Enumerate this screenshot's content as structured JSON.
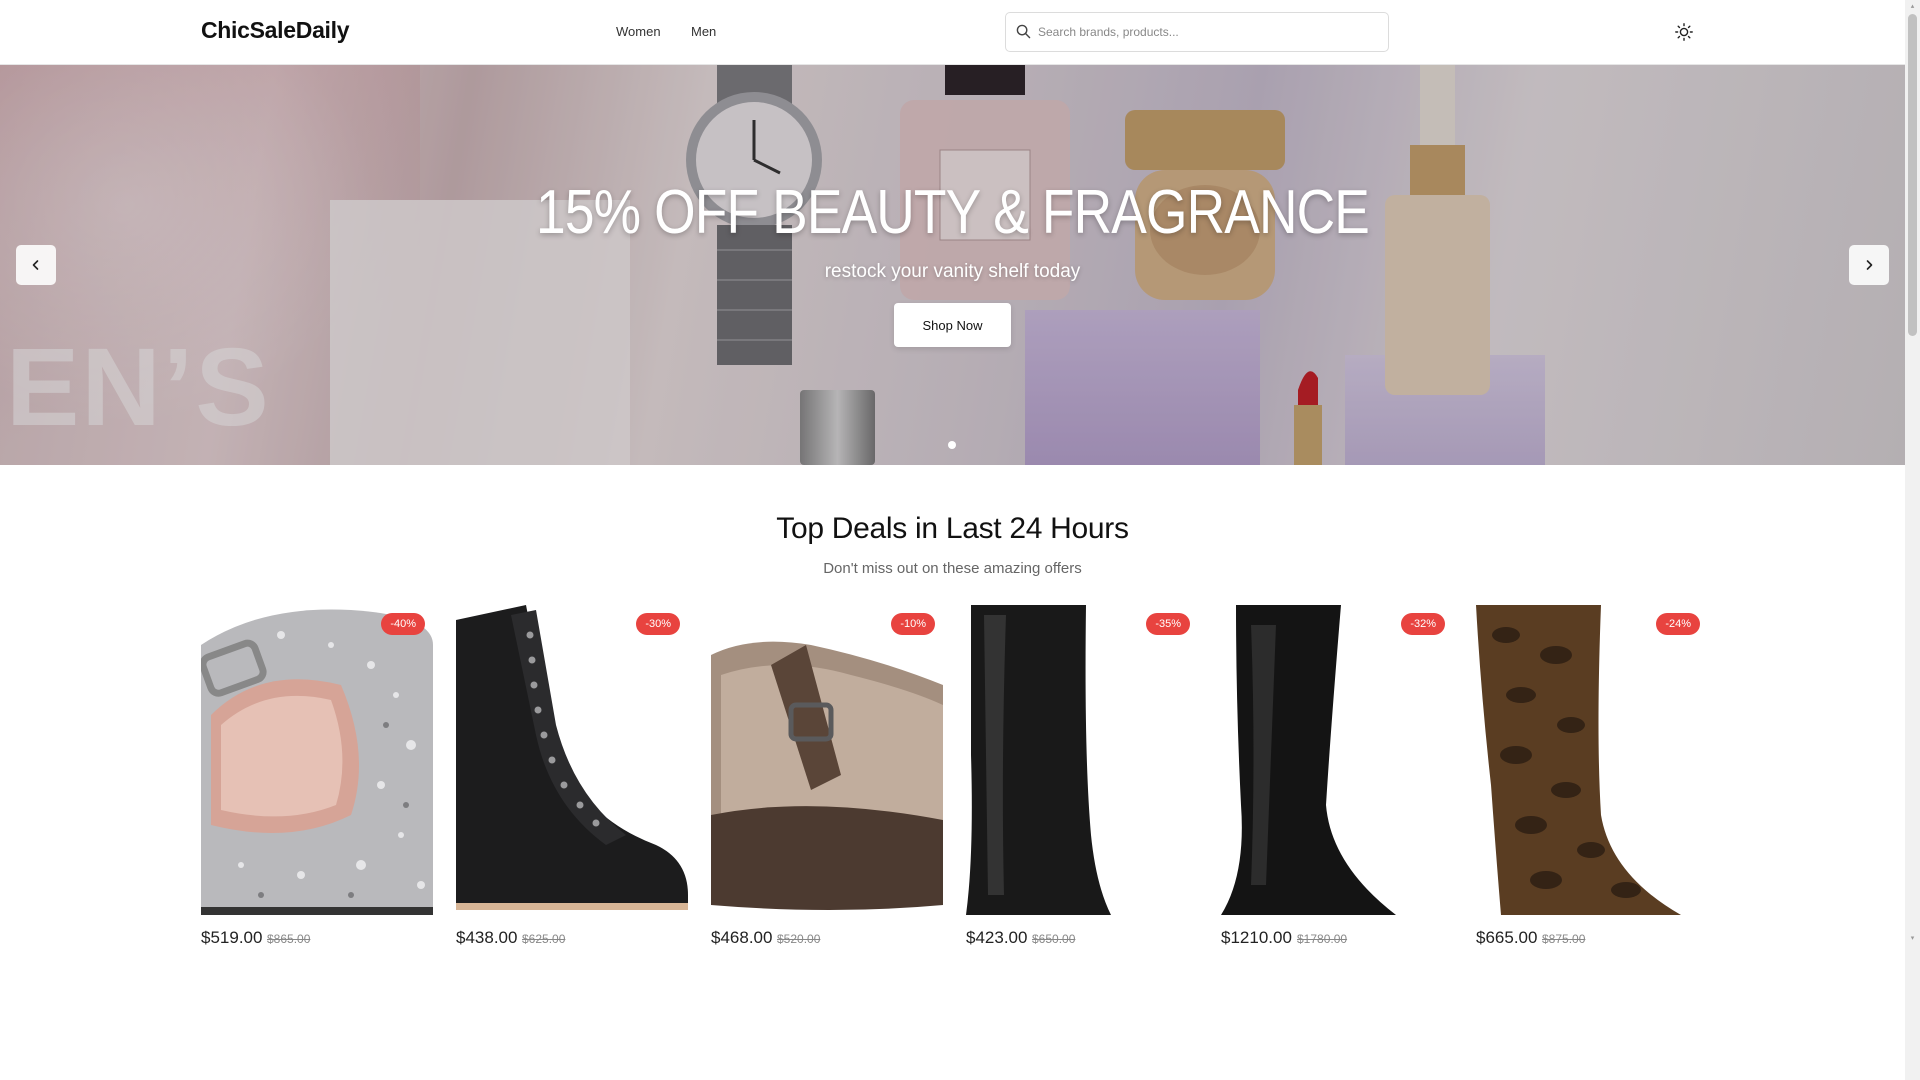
{
  "header": {
    "logo": "ChicSaleDaily",
    "nav": [
      "Women",
      "Men"
    ],
    "search_placeholder": "Search brands, products...",
    "theme_icon": "sun-icon"
  },
  "hero": {
    "title": "15% OFF BEAUTY & FRAGRANCE",
    "subtitle": "restock your vanity shelf today",
    "cta": "Shop Now",
    "prev_icon": "chevron-left-icon",
    "next_icon": "chevron-right-icon",
    "slide_count": 1,
    "active_slide": 1
  },
  "deals": {
    "title": "Top Deals in Last 24 Hours",
    "subtitle": "Don't miss out on these amazing offers",
    "products": [
      {
        "discount": "-40%",
        "price": "$519.00",
        "old_price": "$865.00",
        "image": "silver glitter buckle shoe"
      },
      {
        "discount": "-30%",
        "price": "$438.00",
        "old_price": "$625.00",
        "image": "black lace-up ankle boot"
      },
      {
        "discount": "-10%",
        "price": "$468.00",
        "old_price": "$520.00",
        "image": "shearling mary jane"
      },
      {
        "discount": "-35%",
        "price": "$423.00",
        "old_price": "$650.00",
        "image": "black knee-high boot"
      },
      {
        "discount": "-32%",
        "price": "$1210.00",
        "old_price": "$1780.00",
        "image": "black slouch knee boot"
      },
      {
        "discount": "-24%",
        "price": "$665.00",
        "old_price": "$875.00",
        "image": "snakeskin knee boot"
      }
    ]
  },
  "colors": {
    "badge": "#e8433f",
    "text": "#111111"
  }
}
